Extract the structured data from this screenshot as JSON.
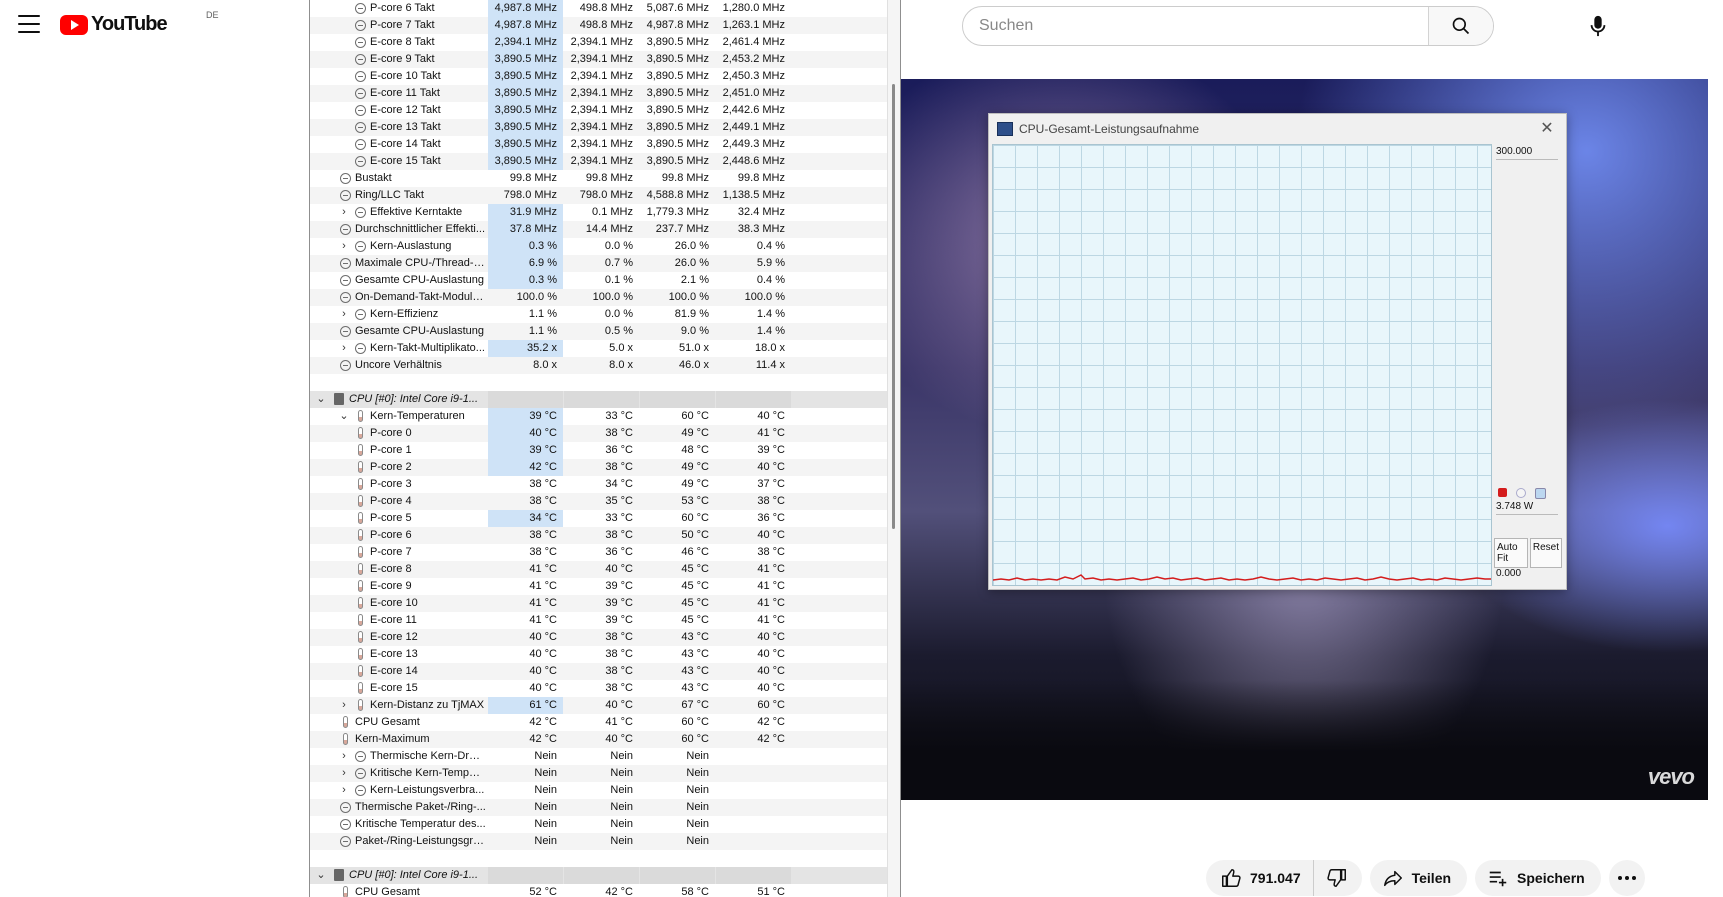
{
  "youtube": {
    "logo_text": "YouTube",
    "country_code": "DE",
    "search_placeholder": "Suchen",
    "likes": "791.047",
    "share_label": "Teilen",
    "save_label": "Speichern",
    "video_watermark": "vevo",
    "icons": [
      "menu-icon",
      "search-icon",
      "mic-icon",
      "like-icon",
      "dislike-icon",
      "share-icon",
      "save-icon",
      "more-icon"
    ]
  },
  "graph_window": {
    "title": "CPU-Gesamt-Leistungsaufnahme",
    "max_label": "300.000",
    "current_label": "3.748 W",
    "min_label": "0.000",
    "auto_fit_label": "Auto Fit",
    "reset_label": "Reset",
    "line_color": "#d41c1c",
    "grid_color": "#bcd7e3",
    "plot_background": "#e8f6fb"
  },
  "sensors": {
    "highlight_color": "#cfe3f7",
    "rows": [
      {
        "type": "item",
        "indent": 2,
        "icon": "clock",
        "label": "P-core 6 Takt",
        "values": [
          "4,987.8 MHz",
          "498.8 MHz",
          "5,087.6 MHz",
          "1,280.0 MHz"
        ],
        "hl": true
      },
      {
        "type": "item",
        "indent": 2,
        "icon": "clock",
        "label": "P-core 7 Takt",
        "values": [
          "4,987.8 MHz",
          "498.8 MHz",
          "4,987.8 MHz",
          "1,263.1 MHz"
        ],
        "hl": true
      },
      {
        "type": "item",
        "indent": 2,
        "icon": "clock",
        "label": "E-core 8 Takt",
        "values": [
          "2,394.1 MHz",
          "2,394.1 MHz",
          "3,890.5 MHz",
          "2,461.4 MHz"
        ],
        "hl": true
      },
      {
        "type": "item",
        "indent": 2,
        "icon": "clock",
        "label": "E-core 9 Takt",
        "values": [
          "3,890.5 MHz",
          "2,394.1 MHz",
          "3,890.5 MHz",
          "2,453.2 MHz"
        ],
        "hl": true
      },
      {
        "type": "item",
        "indent": 2,
        "icon": "clock",
        "label": "E-core 10 Takt",
        "values": [
          "3,890.5 MHz",
          "2,394.1 MHz",
          "3,890.5 MHz",
          "2,450.3 MHz"
        ],
        "hl": true
      },
      {
        "type": "item",
        "indent": 2,
        "icon": "clock",
        "label": "E-core 11 Takt",
        "values": [
          "3,890.5 MHz",
          "2,394.1 MHz",
          "3,890.5 MHz",
          "2,451.0 MHz"
        ],
        "hl": true
      },
      {
        "type": "item",
        "indent": 2,
        "icon": "clock",
        "label": "E-core 12 Takt",
        "values": [
          "3,890.5 MHz",
          "2,394.1 MHz",
          "3,890.5 MHz",
          "2,442.6 MHz"
        ],
        "hl": true
      },
      {
        "type": "item",
        "indent": 2,
        "icon": "clock",
        "label": "E-core 13 Takt",
        "values": [
          "3,890.5 MHz",
          "2,394.1 MHz",
          "3,890.5 MHz",
          "2,449.1 MHz"
        ],
        "hl": true
      },
      {
        "type": "item",
        "indent": 2,
        "icon": "clock",
        "label": "E-core 14 Takt",
        "values": [
          "3,890.5 MHz",
          "2,394.1 MHz",
          "3,890.5 MHz",
          "2,449.3 MHz"
        ],
        "hl": true
      },
      {
        "type": "item",
        "indent": 2,
        "icon": "clock",
        "label": "E-core 15 Takt",
        "values": [
          "3,890.5 MHz",
          "2,394.1 MHz",
          "3,890.5 MHz",
          "2,448.6 MHz"
        ],
        "hl": true
      },
      {
        "type": "item",
        "indent": 1,
        "icon": "clock",
        "label": "Bustakt",
        "values": [
          "99.8 MHz",
          "99.8 MHz",
          "99.8 MHz",
          "99.8 MHz"
        ],
        "hl": false
      },
      {
        "type": "item",
        "indent": 1,
        "icon": "clock",
        "label": "Ring/LLC Takt",
        "values": [
          "798.0 MHz",
          "798.0 MHz",
          "4,588.8 MHz",
          "1,138.5 MHz"
        ],
        "hl": false
      },
      {
        "type": "item",
        "indent": 2,
        "exp": ">",
        "icon": "clock",
        "label": "Effektive Kerntakte",
        "values": [
          "31.9 MHz",
          "0.1 MHz",
          "1,779.3 MHz",
          "32.4 MHz"
        ],
        "hl": true
      },
      {
        "type": "item",
        "indent": 1,
        "icon": "clock",
        "label": "Durchschnittlicher Effekti...",
        "values": [
          "37.8 MHz",
          "14.4 MHz",
          "237.7 MHz",
          "38.3 MHz"
        ],
        "hl": true
      },
      {
        "type": "item",
        "indent": 2,
        "exp": ">",
        "icon": "clock",
        "label": "Kern-Auslastung",
        "values": [
          "0.3 %",
          "0.0 %",
          "26.0 %",
          "0.4 %"
        ],
        "hl": true
      },
      {
        "type": "item",
        "indent": 1,
        "icon": "clock",
        "label": "Maximale CPU-/Thread-A...",
        "values": [
          "6.9 %",
          "0.7 %",
          "26.0 %",
          "5.9 %"
        ],
        "hl": true
      },
      {
        "type": "item",
        "indent": 1,
        "icon": "clock",
        "label": "Gesamte CPU-Auslastung",
        "values": [
          "0.3 %",
          "0.1 %",
          "2.1 %",
          "0.4 %"
        ],
        "hl": true
      },
      {
        "type": "item",
        "indent": 1,
        "icon": "clock",
        "label": "On-Demand-Takt-Modula...",
        "values": [
          "100.0 %",
          "100.0 %",
          "100.0 %",
          "100.0 %"
        ],
        "hl": false
      },
      {
        "type": "item",
        "indent": 2,
        "exp": ">",
        "icon": "clock",
        "label": "Kern-Effizienz",
        "values": [
          "1.1 %",
          "0.0 %",
          "81.9 %",
          "1.4 %"
        ],
        "hl": false
      },
      {
        "type": "item",
        "indent": 1,
        "icon": "clock",
        "label": "Gesamte CPU-Auslastung",
        "values": [
          "1.1 %",
          "0.5 %",
          "9.0 %",
          "1.4 %"
        ],
        "hl": false
      },
      {
        "type": "item",
        "indent": 2,
        "exp": ">",
        "icon": "clock",
        "label": "Kern-Takt-Multiplikato...",
        "values": [
          "35.2 x",
          "5.0 x",
          "51.0 x",
          "18.0 x"
        ],
        "hl": true
      },
      {
        "type": "item",
        "indent": 1,
        "icon": "clock",
        "label": "Uncore Verhältnis",
        "values": [
          "8.0 x",
          "8.0 x",
          "46.0 x",
          "11.4 x"
        ],
        "hl": false
      },
      {
        "type": "blank"
      },
      {
        "type": "group",
        "label": "CPU [#0]: Intel Core i9-1..."
      },
      {
        "type": "item",
        "indent": 2,
        "exp": "v",
        "icon": "therm",
        "label": "Kern-Temperaturen",
        "values": [
          "39 °C",
          "33 °C",
          "60 °C",
          "40 °C"
        ],
        "hl": true
      },
      {
        "type": "item",
        "indent": 2,
        "icon": "therm",
        "label": "P-core 0",
        "values": [
          "40 °C",
          "38 °C",
          "49 °C",
          "41 °C"
        ],
        "hl": true
      },
      {
        "type": "item",
        "indent": 2,
        "icon": "therm",
        "label": "P-core 1",
        "values": [
          "39 °C",
          "36 °C",
          "48 °C",
          "39 °C"
        ],
        "hl": true
      },
      {
        "type": "item",
        "indent": 2,
        "icon": "therm",
        "label": "P-core 2",
        "values": [
          "42 °C",
          "38 °C",
          "49 °C",
          "40 °C"
        ],
        "hl": true
      },
      {
        "type": "item",
        "indent": 2,
        "icon": "therm",
        "label": "P-core 3",
        "values": [
          "38 °C",
          "34 °C",
          "49 °C",
          "37 °C"
        ],
        "hl": false
      },
      {
        "type": "item",
        "indent": 2,
        "icon": "therm",
        "label": "P-core 4",
        "values": [
          "38 °C",
          "35 °C",
          "53 °C",
          "38 °C"
        ],
        "hl": false
      },
      {
        "type": "item",
        "indent": 2,
        "icon": "therm",
        "label": "P-core 5",
        "values": [
          "34 °C",
          "33 °C",
          "60 °C",
          "36 °C"
        ],
        "hl": true
      },
      {
        "type": "item",
        "indent": 2,
        "icon": "therm",
        "label": "P-core 6",
        "values": [
          "38 °C",
          "38 °C",
          "50 °C",
          "40 °C"
        ],
        "hl": false
      },
      {
        "type": "item",
        "indent": 2,
        "icon": "therm",
        "label": "P-core 7",
        "values": [
          "38 °C",
          "36 °C",
          "46 °C",
          "38 °C"
        ],
        "hl": false
      },
      {
        "type": "item",
        "indent": 2,
        "icon": "therm",
        "label": "E-core 8",
        "values": [
          "41 °C",
          "40 °C",
          "45 °C",
          "41 °C"
        ],
        "hl": false
      },
      {
        "type": "item",
        "indent": 2,
        "icon": "therm",
        "label": "E-core 9",
        "values": [
          "41 °C",
          "39 °C",
          "45 °C",
          "41 °C"
        ],
        "hl": false
      },
      {
        "type": "item",
        "indent": 2,
        "icon": "therm",
        "label": "E-core 10",
        "values": [
          "41 °C",
          "39 °C",
          "45 °C",
          "41 °C"
        ],
        "hl": false
      },
      {
        "type": "item",
        "indent": 2,
        "icon": "therm",
        "label": "E-core 11",
        "values": [
          "41 °C",
          "39 °C",
          "45 °C",
          "41 °C"
        ],
        "hl": false
      },
      {
        "type": "item",
        "indent": 2,
        "icon": "therm",
        "label": "E-core 12",
        "values": [
          "40 °C",
          "38 °C",
          "43 °C",
          "40 °C"
        ],
        "hl": false
      },
      {
        "type": "item",
        "indent": 2,
        "icon": "therm",
        "label": "E-core 13",
        "values": [
          "40 °C",
          "38 °C",
          "43 °C",
          "40 °C"
        ],
        "hl": false
      },
      {
        "type": "item",
        "indent": 2,
        "icon": "therm",
        "label": "E-core 14",
        "values": [
          "40 °C",
          "38 °C",
          "43 °C",
          "40 °C"
        ],
        "hl": false
      },
      {
        "type": "item",
        "indent": 2,
        "icon": "therm",
        "label": "E-core 15",
        "values": [
          "40 °C",
          "38 °C",
          "43 °C",
          "40 °C"
        ],
        "hl": false
      },
      {
        "type": "item",
        "indent": 2,
        "exp": ">",
        "icon": "therm",
        "label": "Kern-Distanz zu TjMAX",
        "values": [
          "61 °C",
          "40 °C",
          "67 °C",
          "60 °C"
        ],
        "hl": true
      },
      {
        "type": "item",
        "indent": 1,
        "icon": "therm",
        "label": "CPU Gesamt",
        "values": [
          "42 °C",
          "41 °C",
          "60 °C",
          "42 °C"
        ],
        "hl": false
      },
      {
        "type": "item",
        "indent": 1,
        "icon": "therm",
        "label": "Kern-Maximum",
        "values": [
          "42 °C",
          "40 °C",
          "60 °C",
          "42 °C"
        ],
        "hl": false
      },
      {
        "type": "item",
        "indent": 2,
        "exp": ">",
        "icon": "clock",
        "label": "Thermische Kern-Dros...",
        "values": [
          "Nein",
          "Nein",
          "Nein",
          ""
        ],
        "hl": false
      },
      {
        "type": "item",
        "indent": 2,
        "exp": ">",
        "icon": "clock",
        "label": "Kritische Kern-Temper...",
        "values": [
          "Nein",
          "Nein",
          "Nein",
          ""
        ],
        "hl": false
      },
      {
        "type": "item",
        "indent": 2,
        "exp": ">",
        "icon": "clock",
        "label": "Kern-Leistungsverbra...",
        "values": [
          "Nein",
          "Nein",
          "Nein",
          ""
        ],
        "hl": false
      },
      {
        "type": "item",
        "indent": 1,
        "icon": "clock",
        "label": "Thermische Paket-/Ring-...",
        "values": [
          "Nein",
          "Nein",
          "Nein",
          ""
        ],
        "hl": false
      },
      {
        "type": "item",
        "indent": 1,
        "icon": "clock",
        "label": "Kritische Temperatur des...",
        "values": [
          "Nein",
          "Nein",
          "Nein",
          ""
        ],
        "hl": false
      },
      {
        "type": "item",
        "indent": 1,
        "icon": "clock",
        "label": "Paket-/Ring-Leistungsgre...",
        "values": [
          "Nein",
          "Nein",
          "Nein",
          ""
        ],
        "hl": false
      },
      {
        "type": "blank"
      },
      {
        "type": "group",
        "label": "CPU [#0]: Intel Core i9-1..."
      },
      {
        "type": "item",
        "indent": 1,
        "icon": "therm",
        "label": "CPU Gesamt",
        "values": [
          "52 °C",
          "42 °C",
          "58 °C",
          "51 °C"
        ],
        "hl": false
      }
    ]
  }
}
